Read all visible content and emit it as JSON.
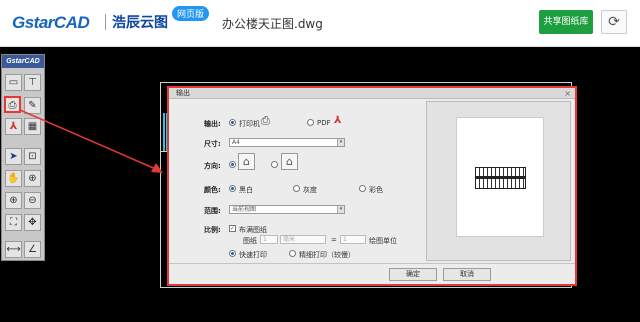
{
  "header": {
    "logo_text": "GstarCAD",
    "logo_cn": "浩辰云图",
    "badge": "网页版",
    "file_title": "办公楼天正图.dwg",
    "share_label": "共享图纸库",
    "refresh_icon": "refresh-icon"
  },
  "toolpanel": {
    "title": "GstarCAD",
    "tools": [
      "open-icon",
      "measure-icon",
      "print-icon",
      "edit-icon",
      "pdf-icon",
      "image-icon",
      "select-cursor-icon",
      "zoom-window-icon",
      "pan-hand-icon",
      "zoom-extents-icon",
      "zoom-in-icon",
      "zoom-out-icon",
      "fit-icon",
      "full-screen-icon",
      "dimension-icon",
      "angle-icon"
    ]
  },
  "dialog": {
    "title": "输出",
    "close": "×",
    "output_label": "输出:",
    "output_printer": "打印机",
    "output_pdf": "PDF",
    "size_label": "尺寸:",
    "size_value": "A4",
    "direction_label": "方向:",
    "color_label": "颜色:",
    "color_bw": "黑白",
    "color_gray": "灰度",
    "color_color": "彩色",
    "range_label": "范围:",
    "range_value": "当前视图",
    "scale_label": "比例:",
    "fit_paper": "布满图纸",
    "paper_label": "图纸",
    "paper_value": "1",
    "unit_value": "毫米",
    "equals": "=",
    "drawing_value": "1",
    "drawing_unit": "绘图单位",
    "fast_print": "快速打印",
    "fine_print": "精细打印（较慢）",
    "ok": "确定",
    "cancel": "取消"
  },
  "colors": {
    "accent_red": "#e53935",
    "share_green": "#1e9e3e",
    "brand_blue": "#1565c0"
  }
}
